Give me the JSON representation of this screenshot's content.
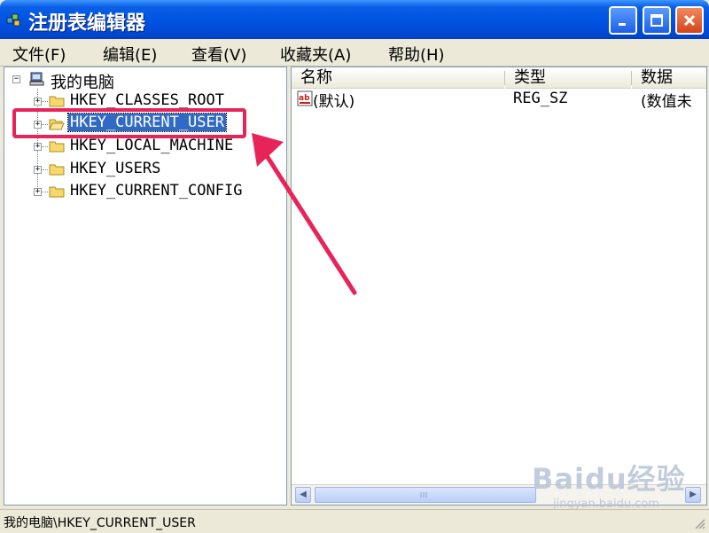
{
  "window": {
    "title": "注册表编辑器"
  },
  "menubar": {
    "items": [
      "文件(F)",
      "编辑(E)",
      "查看(V)",
      "收藏夹(A)",
      "帮助(H)"
    ]
  },
  "tree": {
    "root_label": "我的电脑",
    "items": [
      {
        "label": "HKEY_CLASSES_ROOT",
        "selected": false
      },
      {
        "label": "HKEY_CURRENT_USER",
        "selected": true
      },
      {
        "label": "HKEY_LOCAL_MACHINE",
        "selected": false
      },
      {
        "label": "HKEY_USERS",
        "selected": false
      },
      {
        "label": "HKEY_CURRENT_CONFIG",
        "selected": false
      }
    ]
  },
  "list": {
    "columns": [
      "名称",
      "类型",
      "数据"
    ],
    "rows": [
      {
        "name": "(默认)",
        "type": "REG_SZ",
        "data": "(数值未"
      }
    ]
  },
  "status": {
    "path": "我的电脑\\HKEY_CURRENT_USER"
  },
  "watermark": {
    "brand": "Baidu经验",
    "url": "jingyan.baidu.com"
  },
  "colors": {
    "title_bar": "#0054e3",
    "selection": "#316ac5",
    "annotation": "#e8235a",
    "window_bg": "#ece9d8"
  },
  "icons": {
    "app": "registry-editor-icon",
    "folder": "folder-icon",
    "computer": "computer-icon",
    "string_value": "reg-sz-value-icon"
  }
}
